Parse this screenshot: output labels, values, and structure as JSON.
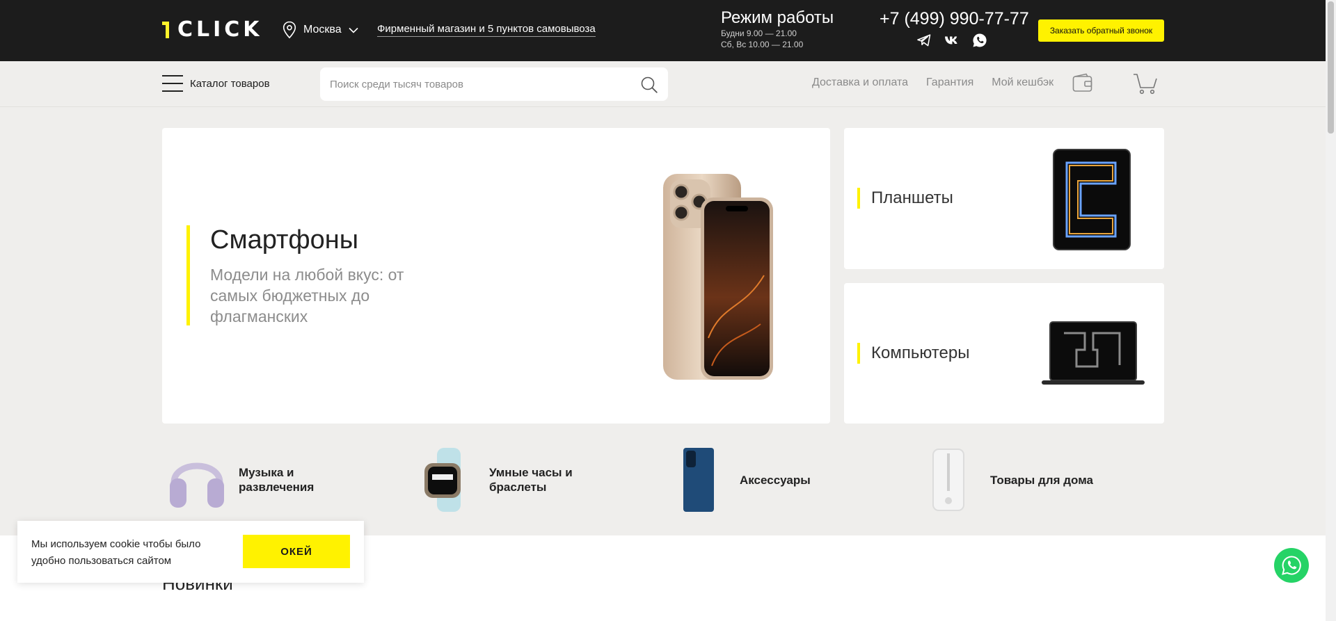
{
  "header": {
    "logo_text": "1CLICK",
    "city": "Москва",
    "store_link": "Фирменный магазин и 5 пунктов самовывоза",
    "hours_title": "Режим работы",
    "hours_weekdays": "Будни 9.00 — 21.00",
    "hours_weekend": "Сб, Вс 10.00 — 21.00",
    "phone": "+7 (499) 990-77-77",
    "socials": [
      "telegram-icon",
      "vk-icon",
      "whatsapp-icon"
    ],
    "callback_button": "Заказать обратный звонок"
  },
  "nav": {
    "catalog_label": "Каталог товаров",
    "search_placeholder": "Поиск среди тысяч товаров",
    "links": [
      "Доставка и оплата",
      "Гарантия",
      "Мой кешбэк"
    ]
  },
  "banners": {
    "main": {
      "title": "Смартфоны",
      "subtitle": "Модели на любой вкус: от самых бюджетных до флагманских"
    },
    "tablets": "Планшеты",
    "computers": "Компьютеры"
  },
  "categories": [
    {
      "label": "Музыка и развлечения"
    },
    {
      "label": "Умные часы и браслеты"
    },
    {
      "label": "Аксессуары"
    },
    {
      "label": "Товары для дома"
    }
  ],
  "section_title": "Новинки",
  "cookie": {
    "text": "Мы используем cookie чтобы было удобно пользоваться сайтом",
    "button": "ОКЕЙ"
  },
  "colors": {
    "accent": "#fff200",
    "header_bg": "#1c1c1c",
    "page_bg": "#efeeec",
    "whatsapp": "#25d366"
  }
}
